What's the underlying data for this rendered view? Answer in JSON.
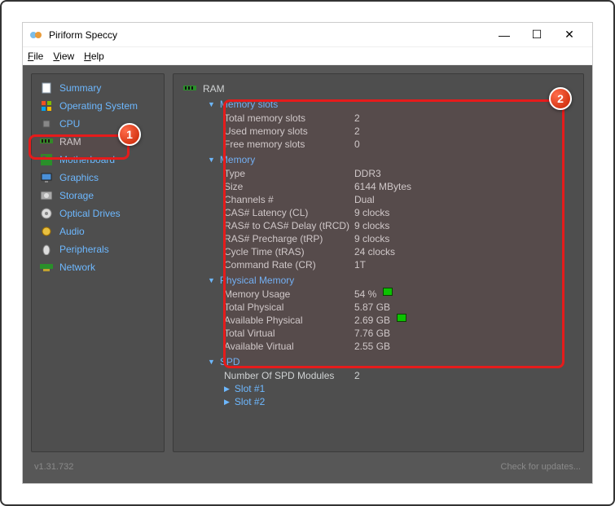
{
  "app": {
    "title": "Piriform Speccy"
  },
  "menu": {
    "file": "File",
    "view": "View",
    "help": "Help"
  },
  "sidebar": {
    "items": [
      {
        "label": "Summary",
        "icon": "summary-icon"
      },
      {
        "label": "Operating System",
        "icon": "os-icon"
      },
      {
        "label": "CPU",
        "icon": "cpu-icon"
      },
      {
        "label": "RAM",
        "icon": "ram-icon",
        "selected": true
      },
      {
        "label": "Motherboard",
        "icon": "motherboard-icon"
      },
      {
        "label": "Graphics",
        "icon": "graphics-icon"
      },
      {
        "label": "Storage",
        "icon": "storage-icon"
      },
      {
        "label": "Optical Drives",
        "icon": "optical-icon"
      },
      {
        "label": "Audio",
        "icon": "audio-icon"
      },
      {
        "label": "Peripherals",
        "icon": "peripherals-icon"
      },
      {
        "label": "Network",
        "icon": "network-icon"
      }
    ]
  },
  "main": {
    "header": "RAM",
    "sections": {
      "memory_slots": {
        "title": "Memory slots",
        "total": {
          "k": "Total memory slots",
          "v": "2"
        },
        "used": {
          "k": "Used memory slots",
          "v": "2"
        },
        "free": {
          "k": "Free memory slots",
          "v": "0"
        }
      },
      "memory": {
        "title": "Memory",
        "type": {
          "k": "Type",
          "v": "DDR3"
        },
        "size": {
          "k": "Size",
          "v": "6144 MBytes"
        },
        "channels": {
          "k": "Channels #",
          "v": "Dual"
        },
        "cl": {
          "k": "CAS# Latency (CL)",
          "v": "9 clocks"
        },
        "trcd": {
          "k": "RAS# to CAS# Delay (tRCD)",
          "v": "9 clocks"
        },
        "trp": {
          "k": "RAS# Precharge (tRP)",
          "v": "9 clocks"
        },
        "tras": {
          "k": "Cycle Time (tRAS)",
          "v": "24 clocks"
        },
        "cr": {
          "k": "Command Rate (CR)",
          "v": "1T"
        }
      },
      "physical": {
        "title": "Physical Memory",
        "usage": {
          "k": "Memory Usage",
          "v": "54 %"
        },
        "tphys": {
          "k": "Total Physical",
          "v": "5.87 GB"
        },
        "aphys": {
          "k": "Available Physical",
          "v": "2.69 GB"
        },
        "tvirt": {
          "k": "Total Virtual",
          "v": "7.76 GB"
        },
        "avirt": {
          "k": "Available Virtual",
          "v": "2.55 GB"
        }
      },
      "spd": {
        "title": "SPD",
        "modules": {
          "k": "Number Of SPD Modules",
          "v": "2"
        },
        "slot1": "Slot #1",
        "slot2": "Slot #2"
      }
    }
  },
  "status": {
    "version": "v1.31.732",
    "update": "Check for updates..."
  },
  "badges": {
    "one": "1",
    "two": "2"
  }
}
